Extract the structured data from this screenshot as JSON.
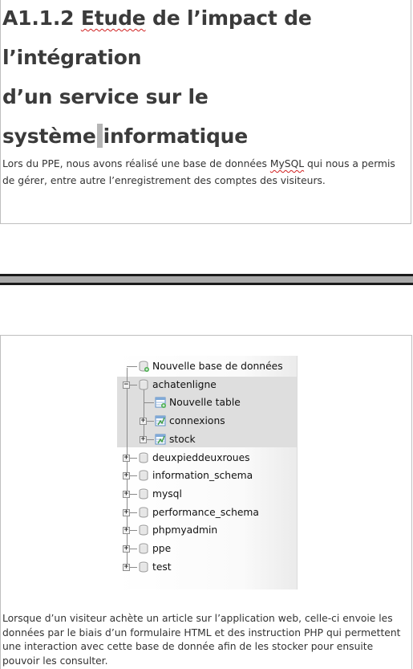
{
  "section1": {
    "heading_parts": [
      "A1.1.2",
      "Etude",
      "de l’impact de l’intégration",
      "d’un service sur le",
      "système",
      "informatique"
    ],
    "paragraph_parts": [
      "Lors du PPE, nous avons réalisé une base de données",
      "MySQL",
      "qui nous a permis de gérer, entre autre l’enregistrement des comptes des visiteurs."
    ]
  },
  "tree": {
    "items": [
      {
        "label": "Nouvelle base de données",
        "icon": "new-database-icon"
      },
      {
        "label": "achatenligne",
        "icon": "database-icon",
        "toggle": "−"
      },
      {
        "label": "Nouvelle table",
        "icon": "new-table-icon"
      },
      {
        "label": "connexions",
        "icon": "table-icon",
        "toggle": "+"
      },
      {
        "label": "stock",
        "icon": "table-icon",
        "toggle": "+"
      },
      {
        "label": "deuxpieddeuxroues",
        "icon": "database-icon",
        "toggle": "+"
      },
      {
        "label": "information_schema",
        "icon": "database-icon",
        "toggle": "+"
      },
      {
        "label": "mysql",
        "icon": "database-icon",
        "toggle": "+"
      },
      {
        "label": "performance_schema",
        "icon": "database-icon",
        "toggle": "+"
      },
      {
        "label": "phpmyadmin",
        "icon": "database-icon",
        "toggle": "+"
      },
      {
        "label": "ppe",
        "icon": "database-icon",
        "toggle": "+"
      },
      {
        "label": "test",
        "icon": "database-icon",
        "toggle": "+"
      }
    ]
  },
  "section2": {
    "paragraph": "Lorsque d’un visiteur achète un article sur l’application web, celle-ci envoie les données par le biais d’un formulaire HTML et des instruction PHP qui permettent une interaction avec cette base de donnée afin de les stocker pour ensuite pouvoir les consulter."
  },
  "colors": {
    "heading": "#3b3b3b",
    "text": "#333333",
    "spellcheck": "#d02020",
    "tree_highlight": "#dedede"
  }
}
